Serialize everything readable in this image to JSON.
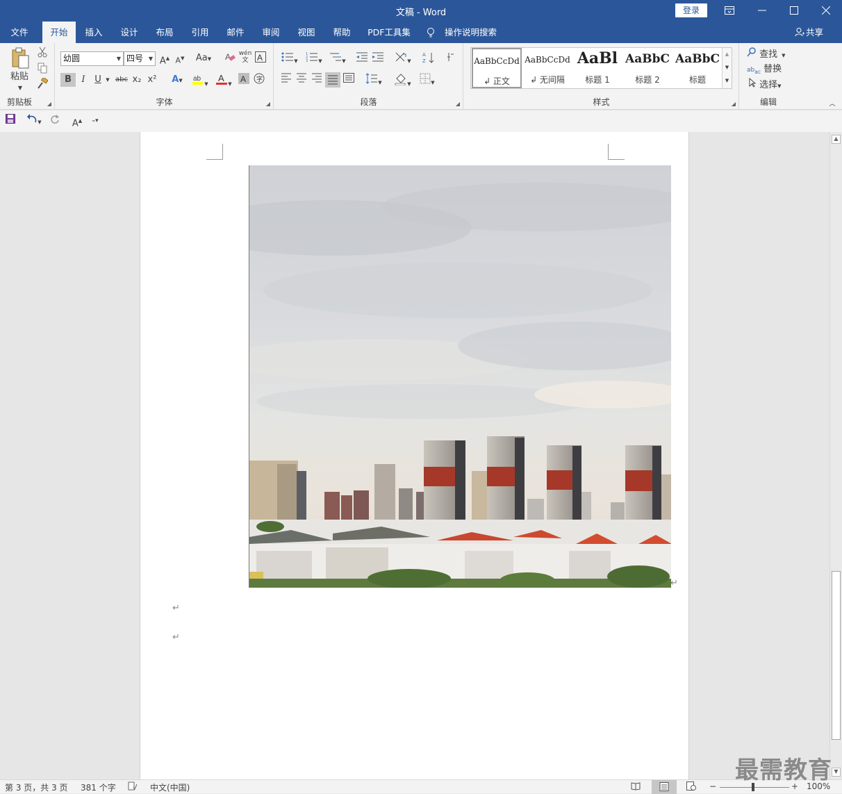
{
  "window": {
    "title": "文稿 - Word",
    "login_label": "登录",
    "share_label": "共享"
  },
  "tabs": [
    "文件",
    "开始",
    "插入",
    "设计",
    "布局",
    "引用",
    "邮件",
    "审阅",
    "视图",
    "帮助",
    "PDF工具集",
    "操作说明搜索"
  ],
  "active_tab": "开始",
  "ribbon": {
    "clipboard": {
      "paste_label": "粘贴",
      "group_label": "剪贴板"
    },
    "font": {
      "font_name": "幼圆",
      "font_size": "四号",
      "group_label": "字体",
      "case_label": "Aa",
      "bold": "B",
      "italic": "I",
      "underline": "U",
      "strike": "abc",
      "sub": "x₂",
      "sup": "x²",
      "font_color_label": "A",
      "pinyin_label": "wén 文"
    },
    "paragraph": {
      "group_label": "段落"
    },
    "styles": {
      "group_label": "样式",
      "items": [
        {
          "preview": "AaBbCcDd",
          "name": "↲ 正文"
        },
        {
          "preview": "AaBbCcDd",
          "name": "↲ 无间隔"
        },
        {
          "preview": "AaBl",
          "name": "标题 1"
        },
        {
          "preview": "AaBbC",
          "name": "标题 2"
        },
        {
          "preview": "AaBbC",
          "name": "标题"
        }
      ]
    },
    "editing": {
      "find_label": "查找",
      "replace_label": "替换",
      "select_label": "选择",
      "group_label": "编辑"
    }
  },
  "statusbar": {
    "page_info": "第 3 页，共 3 页",
    "word_count": "381 个字",
    "language": "中文(中国)",
    "zoom": "100%"
  },
  "document": {
    "paragraph_mark": "↵"
  },
  "watermark": "最需教育"
}
